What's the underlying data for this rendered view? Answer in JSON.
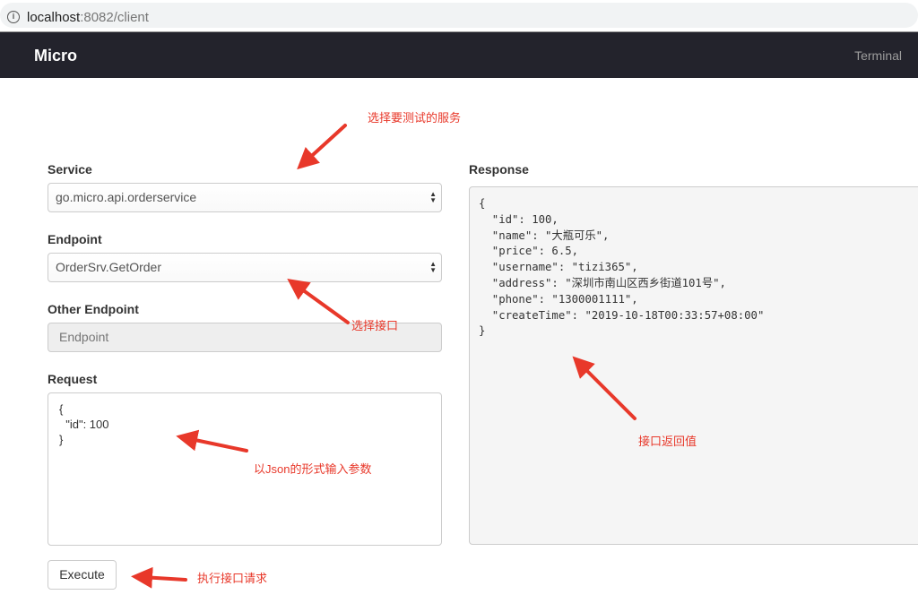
{
  "browser": {
    "url_host": "localhost",
    "url_rest": ":8082/client"
  },
  "navbar": {
    "brand": "Micro",
    "link": "Terminal"
  },
  "form": {
    "service_label": "Service",
    "service_value": "go.micro.api.orderservice",
    "endpoint_label": "Endpoint",
    "endpoint_value": "OrderSrv.GetOrder",
    "other_endpoint_label": "Other Endpoint",
    "other_endpoint_placeholder": "Endpoint",
    "request_label": "Request",
    "request_value": "{\n  \"id\": 100\n}",
    "execute_label": "Execute"
  },
  "response": {
    "label": "Response",
    "body": "{\n  \"id\": 100,\n  \"name\": \"大瓶可乐\",\n  \"price\": 6.5,\n  \"username\": \"tizi365\",\n  \"address\": \"深圳市南山区西乡街道101号\",\n  \"phone\": \"1300001111\",\n  \"createTime\": \"2019-10-18T00:33:57+08:00\"\n}"
  },
  "annotations": {
    "service": "选择要测试的服务",
    "endpoint": "选择接口",
    "request": "以Json的形式输入参数",
    "response": "接口返回值",
    "execute": "执行接口请求"
  },
  "colors": {
    "annotation": "#e8382a",
    "navbar": "#23232c"
  }
}
